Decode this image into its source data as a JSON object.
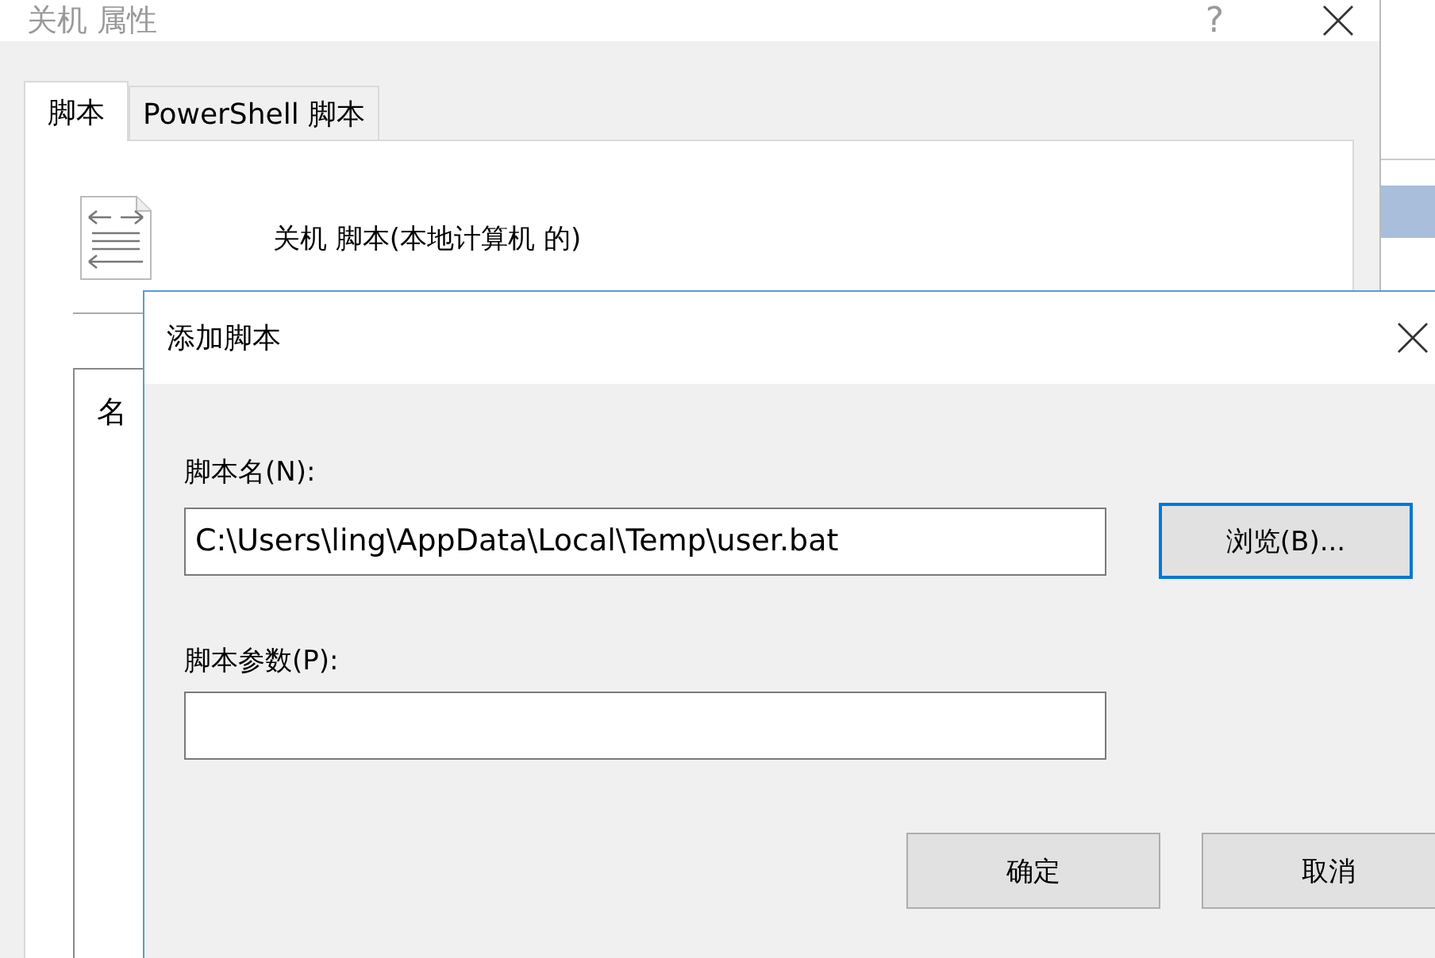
{
  "properties_window": {
    "title": "关机 属性",
    "help_button": "?",
    "tabs": [
      {
        "label": "脚本",
        "selected": true
      },
      {
        "label": "PowerShell 脚本",
        "selected": false
      }
    ],
    "heading": "关机 脚本(本地计算机 的)",
    "list_header": "名"
  },
  "add_script_dialog": {
    "title": "添加脚本",
    "fields": [
      {
        "label": "脚本名(N):",
        "value": "C:\\Users\\ling\\AppData\\Local\\Temp\\user.bat"
      },
      {
        "label": "脚本参数(P):"
      }
    ],
    "browse_button": {
      "label": "浏览(B)...",
      "focused": true
    },
    "buttons": [
      "确定",
      "取消"
    ]
  }
}
